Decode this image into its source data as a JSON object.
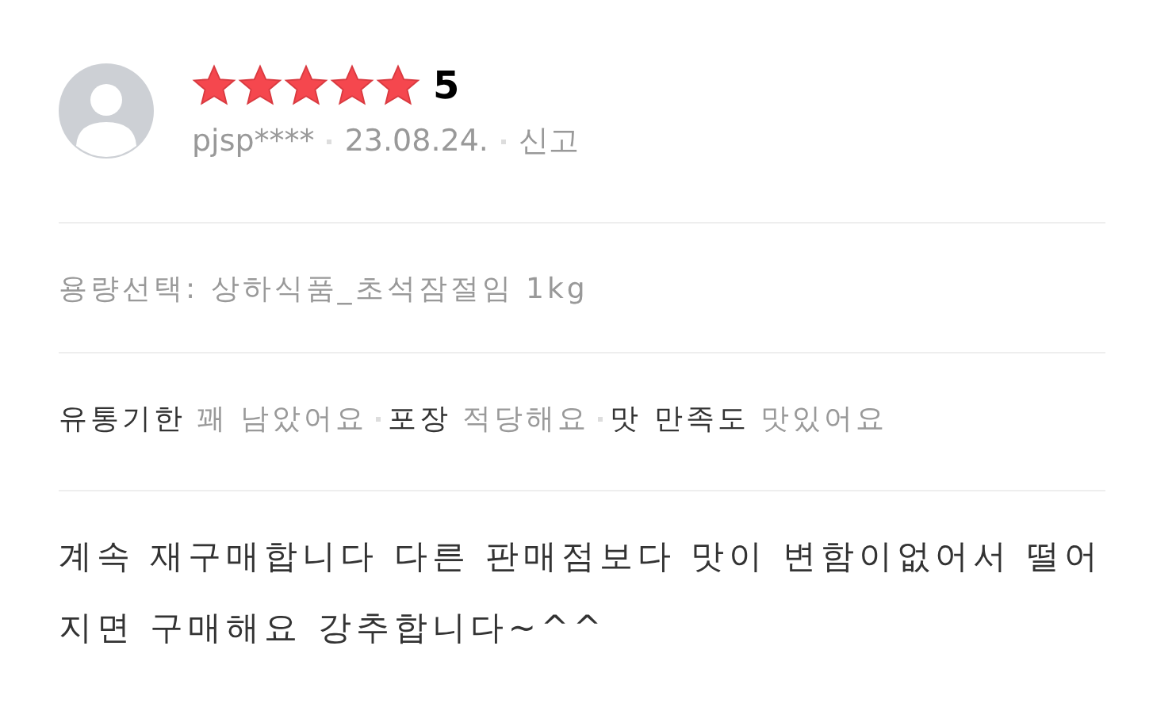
{
  "review": {
    "stars": 5,
    "score": "5",
    "user": "pjsp****",
    "date": "23.08.24.",
    "report": "신고",
    "option": "용량선택: 상하식품_초석잠절임 1kg",
    "attributes": [
      {
        "label": "유통기한",
        "value": "꽤 남았어요"
      },
      {
        "label": "포장",
        "value": "적당해요"
      },
      {
        "label": "맛 만족도",
        "value": "맛있어요"
      }
    ],
    "text": "계속 재구매합니다 다른 판매점보다 맛이 변함이없어서 떨어지면 구매해요 강추합니다~^^"
  }
}
